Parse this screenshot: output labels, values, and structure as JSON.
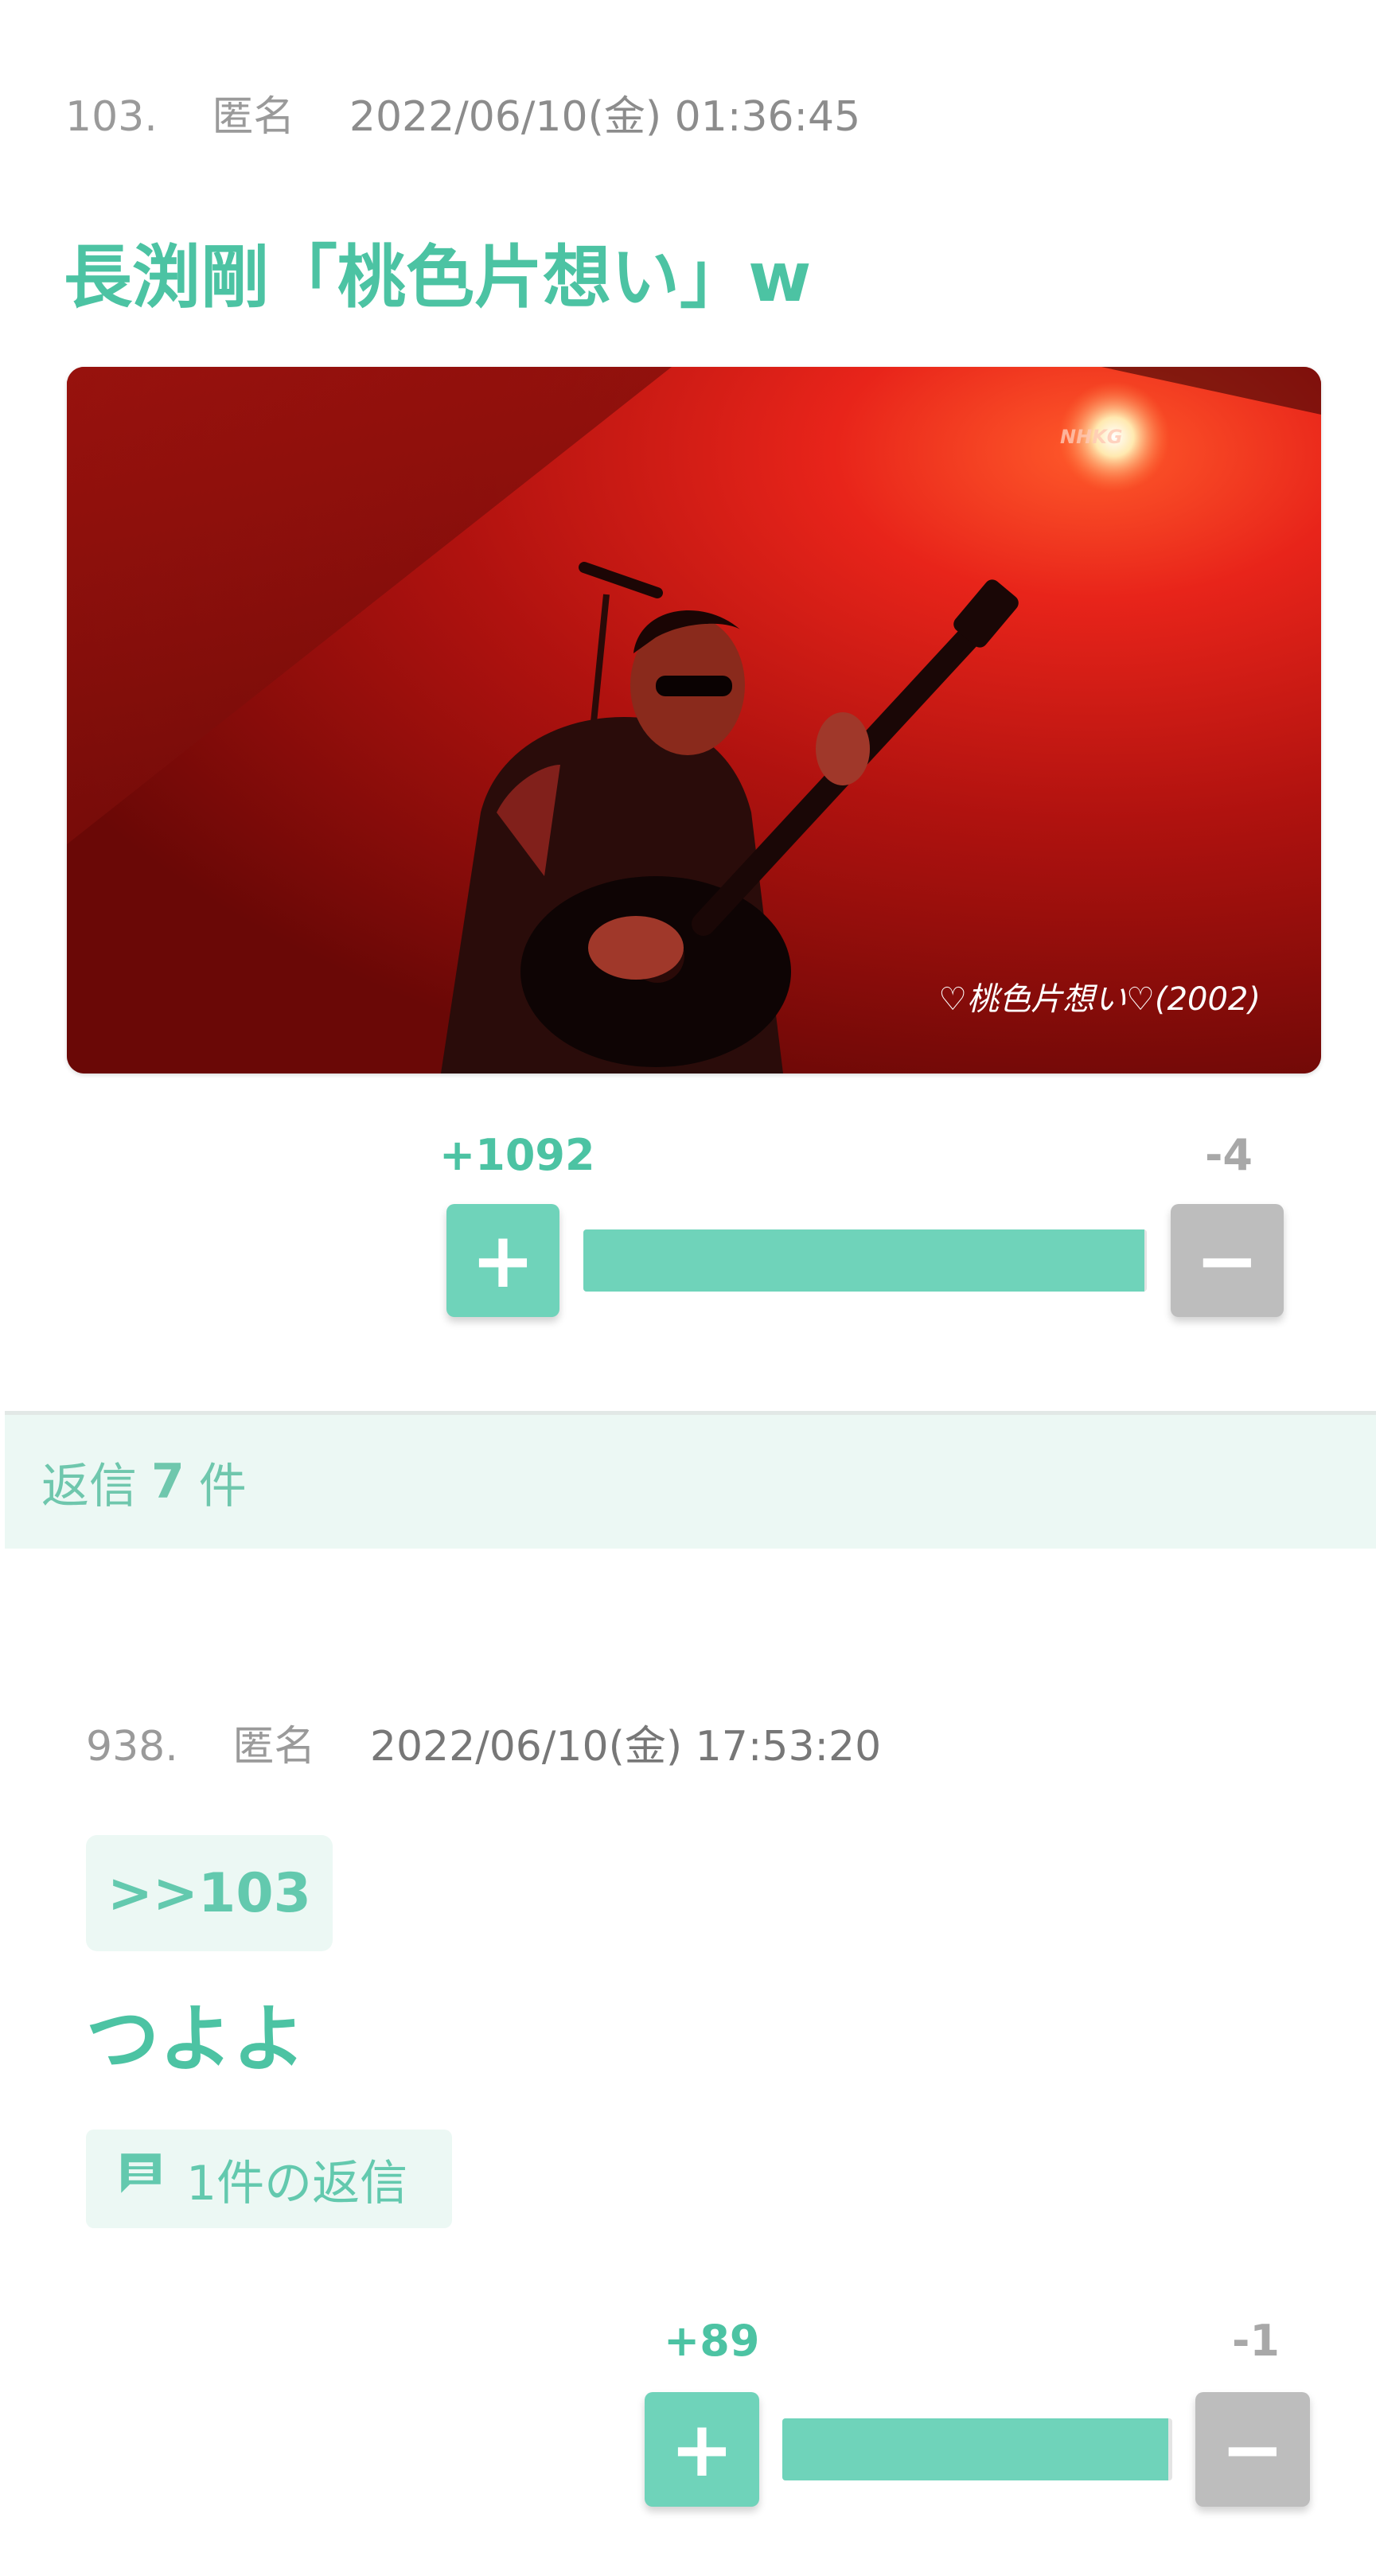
{
  "post1": {
    "number": "103.",
    "author": "匿名",
    "datetime": "2022/06/10(金) 01:36:45",
    "title": "長渕剛「桃色片想い」w",
    "image": {
      "watermark": "NHKG",
      "caption": "♡桃色片想い♡(2002)"
    },
    "votes": {
      "plus_label": "+1092",
      "minus_label": "-4",
      "plus": 1092,
      "minus": 4,
      "plus_button": "+",
      "minus_button": "−"
    }
  },
  "reply_bar": {
    "prefix": "返信",
    "count": "7",
    "suffix": "件"
  },
  "post2": {
    "number": "938.",
    "author": "匿名",
    "datetime": "2022/06/10(金) 17:53:20",
    "anchor": ">>103",
    "title": "つよよ",
    "replies_link": "1件の返信",
    "votes": {
      "plus_label": "+89",
      "minus_label": "-1",
      "plus": 89,
      "minus": 1,
      "plus_button": "+",
      "minus_button": "−"
    }
  },
  "colors": {
    "accent": "#4cc3a3",
    "vote_plus": "#6fd3ba",
    "vote_minus": "#bdbdbd",
    "chip_bg": "#ecf8f4"
  }
}
